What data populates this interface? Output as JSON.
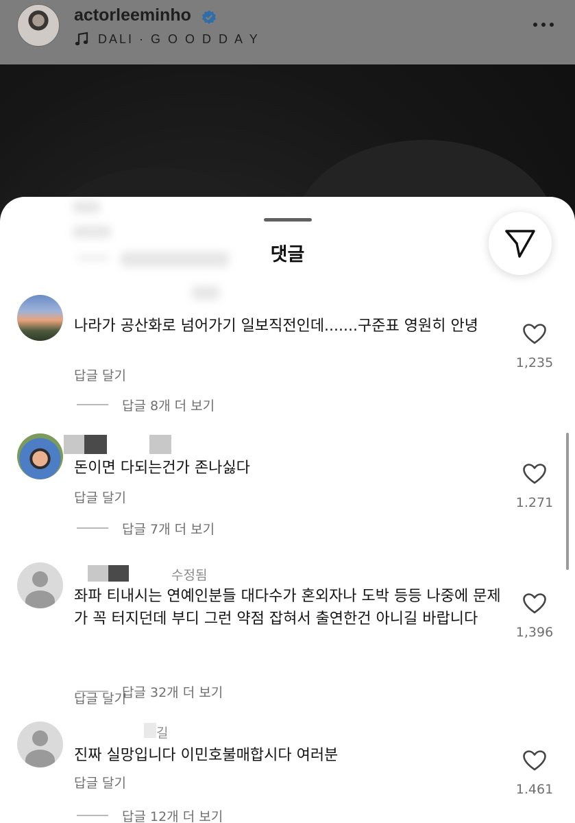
{
  "post": {
    "username": "actorleeminho",
    "song": "DALI · G O O D D A Y"
  },
  "sheet": {
    "title": "댓글"
  },
  "comments": [
    {
      "text": "나라가 공산화로 넘어가기 일보직전인데.......구준표 영원히 안녕",
      "reply_label": "답글 달기",
      "more_replies": "답글 8개 더 보기",
      "likes": "1,235"
    },
    {
      "text": "돈이면 다되는건가 존나싫다",
      "reply_label": "답글 달기",
      "more_replies": "답글 7개 더 보기",
      "likes": "1.271"
    },
    {
      "edited_label": "수정됨",
      "text": "좌파 티내시는 연예인분들 대다수가 혼외자나 도박 등등 나중에 문제가 꼭  터지던데 부디 그런 약점 잡혀서 출연한건 아니길 바랍니다",
      "reply_label": "답글 달기",
      "more_replies": "답글 32개 더 보기",
      "likes": "1,396"
    },
    {
      "name_fragment": "길",
      "text": "진짜 실망입니다 이민호불매합시다 여러분",
      "reply_label": "답글 달기",
      "more_replies": "답글 12개 더 보기",
      "likes": "1.461"
    }
  ]
}
